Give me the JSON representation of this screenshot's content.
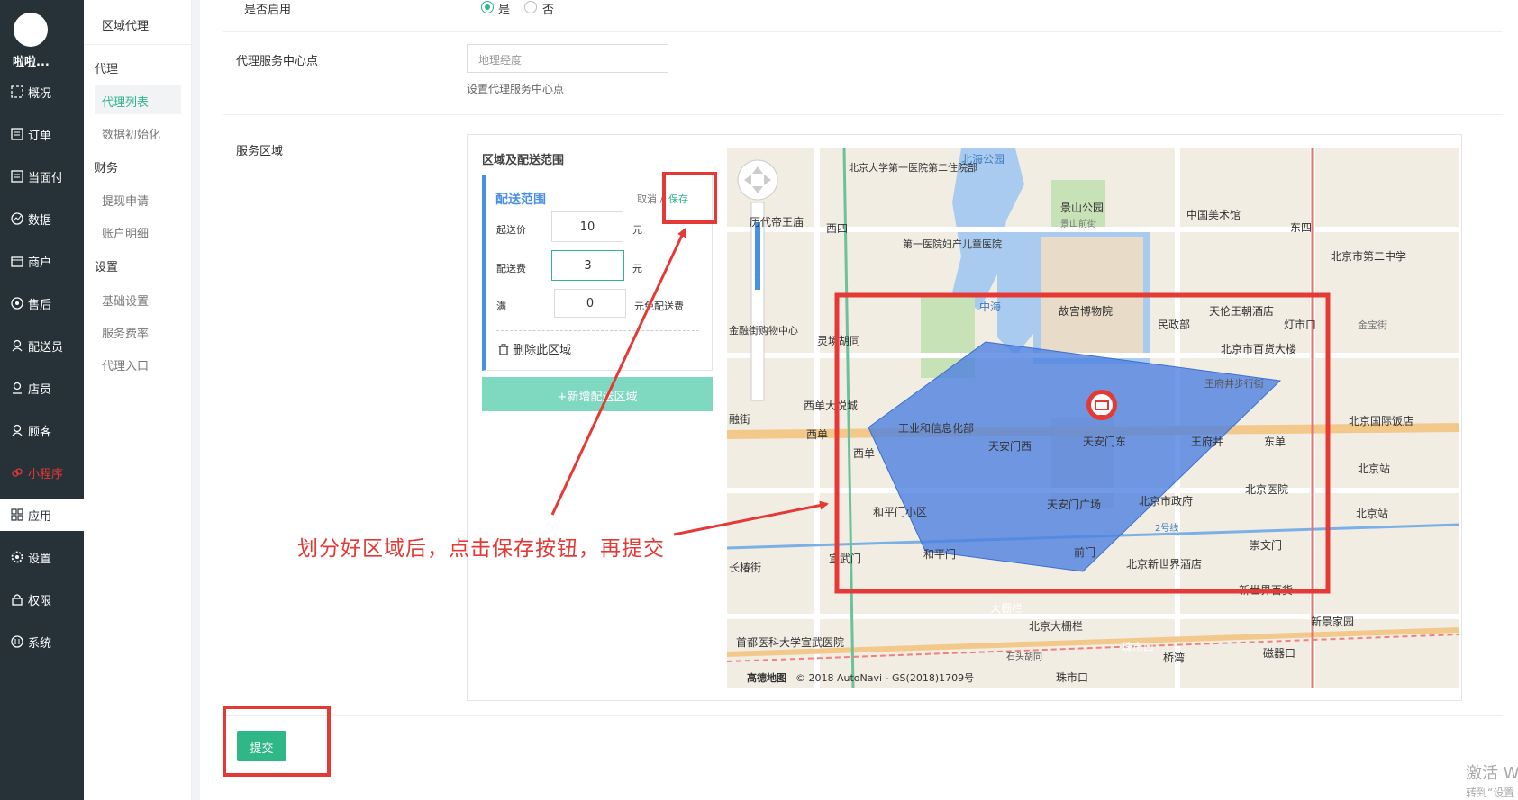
{
  "nav": {
    "user_name": "啦啦...",
    "items": [
      {
        "label": "概况"
      },
      {
        "label": "订单"
      },
      {
        "label": "当面付"
      },
      {
        "label": "数据"
      },
      {
        "label": "商户"
      },
      {
        "label": "售后"
      },
      {
        "label": "配送员"
      },
      {
        "label": "店员"
      },
      {
        "label": "顾客"
      },
      {
        "label": "小程序"
      },
      {
        "label": "应用"
      },
      {
        "label": "设置"
      },
      {
        "label": "权限"
      },
      {
        "label": "系统"
      }
    ]
  },
  "subnav": {
    "title": "区域代理",
    "groups": {
      "agent": "代理",
      "finance": "财务",
      "settings": "设置"
    },
    "links": {
      "agent_list": "代理列表",
      "data_init": "数据初始化",
      "withdraw": "提现申请",
      "account_detail": "账户明细",
      "basic_settings": "基础设置",
      "service_rate": "服务费率",
      "agent_entry": "代理入口"
    }
  },
  "form": {
    "enabled_label": "是否启用",
    "enabled_yes": "是",
    "enabled_no": "否",
    "center_label": "代理服务中心点",
    "center_placeholder": "地理经度",
    "center_hint": "设置代理服务中心点",
    "service_area_label": "服务区域",
    "area_title": "区域及配送范围",
    "zone": {
      "title": "配送范围",
      "cancel": "取消",
      "separator": "/",
      "save": "保存",
      "min_price_label": "起送价",
      "min_price": "10",
      "min_price_unit": "元",
      "delivery_fee_label": "配送费",
      "delivery_fee": "3",
      "delivery_fee_unit": "元",
      "free_label": "满",
      "free_threshold": "0",
      "free_unit": "元免配送费",
      "delete": "删除此区域"
    },
    "add_zone": "+新增配送区域",
    "submit": "提交"
  },
  "annotation": "划分好区域后，点击保存按钮，再提交",
  "map": {
    "labels": {
      "beihai": "北海公园",
      "pku_hospital": "北京大学第一医院第二住院部",
      "jingshan": "景山公园",
      "jingshan_front": "景山前街",
      "art_museum": "中国美术馆",
      "dongsi": "东四",
      "no2_school": "北京市第二中学",
      "xisi": "西四",
      "emperor_temple": "历代帝王庙",
      "first_hospital": "第一医院妇产儿童医院",
      "zhonghai": "中海",
      "palace_museum": "故宫博物院",
      "minzhengbu": "民政部",
      "tianlun": "天伦王朝酒店",
      "dengshikou": "灯市口",
      "jinbao": "金宝街",
      "jinrong": "金融街购物中心",
      "lingjing": "灵境胡同",
      "baihuo": "北京市百货大楼",
      "wangfujing_street": "王府井步行街",
      "xidan_joy": "西单大悦城",
      "miit": "工业和信息化部",
      "intl_hotel": "北京国际饭店",
      "xidan": "西单",
      "tiananmen_west": "天安门西",
      "tiananmen_east": "天安门东",
      "wangfujing": "王府井",
      "dongdan": "东单",
      "beijing_station": "北京站",
      "xidan2": "西单",
      "peking_hospital": "北京医院",
      "tiananmen_square": "天安门广场",
      "gov": "北京市政府",
      "beijingzhan2": "北京站",
      "heping_community": "和平门小区",
      "line2": "2号线",
      "xuanwumen": "宣武门",
      "hepingmen": "和平门",
      "qianmen": "前门",
      "new_world": "北京新世界酒店",
      "chongwenmen": "崇文门",
      "new_world_mall": "新世界百货",
      "dashilan": "大栅栏",
      "dashilan2": "北京大栅栏",
      "xinjing": "新景家园",
      "xuanwu_hospital": "首都医科大学宣武医院",
      "shitou": "石头胡同",
      "zhushikou": "珠市口",
      "zhushikou2": "珠市口",
      "qiaowan": "桥湾",
      "ciqikou": "磁器口",
      "xinghuajie": "幸福大街",
      "rongjie": "融街",
      "changchunjie": "长椿街",
      "copyright": "© 2018 AutoNavi - GS(2018)1709号",
      "logo": "高德地图"
    }
  },
  "watermark": {
    "line1": "激活 W",
    "line2": "转到“设置"
  },
  "colors": {
    "nav_bg": "#263238",
    "accent": "#2fb787",
    "annotation_red": "#e53935",
    "polygon": "#4a7fe0"
  }
}
